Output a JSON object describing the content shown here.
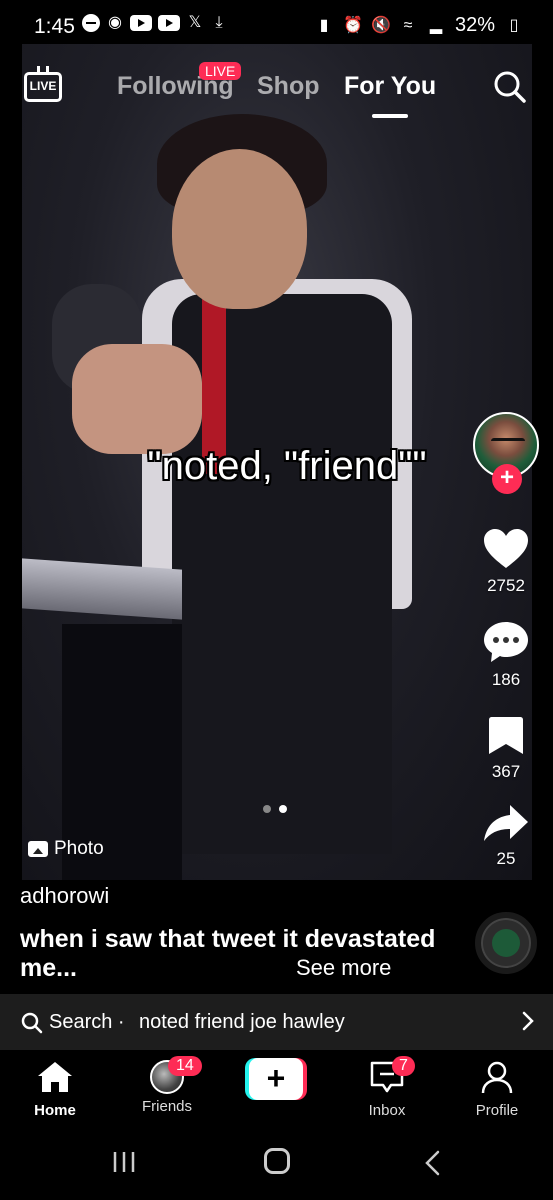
{
  "status_bar": {
    "time": "1:45",
    "battery": "32%"
  },
  "top_nav": {
    "tabs": [
      "Following",
      "Shop",
      "For You"
    ],
    "active_tab": "For You",
    "live_badge": "LIVE",
    "live_icon_text": "LIVE"
  },
  "video": {
    "caption": "\"noted, \"friend\"\"",
    "photo_label": "Photo",
    "carousel_total": 2,
    "carousel_active": 2
  },
  "actions": {
    "likes": "2752",
    "comments": "186",
    "saves": "367",
    "shares": "25"
  },
  "post": {
    "author": "adhorowi",
    "description": "when i saw that tweet it devastated me...",
    "see_more": "See more"
  },
  "search_suggestion": {
    "prefix": "Search ·",
    "query": "noted friend joe hawley"
  },
  "bottom_tabs": {
    "home": "Home",
    "friends": "Friends",
    "friends_badge": "14",
    "inbox": "Inbox",
    "inbox_badge": "7",
    "profile": "Profile",
    "create": "+"
  },
  "colors": {
    "accent": "#fe2c55",
    "cyan": "#25f4ee"
  }
}
